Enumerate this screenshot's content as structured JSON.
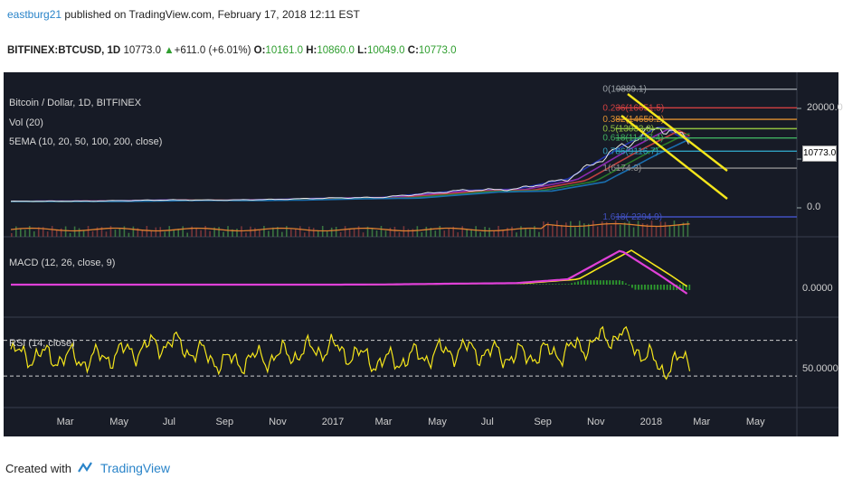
{
  "header": {
    "user": "eastburg21",
    "published": " published on TradingView.com, February 17, 2018 12:11 EST",
    "symbol": "BITFINEX:BTCUSD, 1D",
    "last": "10773.0",
    "change": "+611.0 (+6.01%)",
    "o_label": "O:",
    "o_val": "10161.0",
    "h_label": "H:",
    "h_val": "10860.0",
    "l_label": "L:",
    "l_val": "10049.0",
    "c_label": "C:",
    "c_val": "10773.0"
  },
  "legend": {
    "main": "Bitcoin / Dollar, 1D, BITFINEX",
    "vol": "Vol (20)",
    "sema": "5EMA (10, 20, 50, 100, 200, close)",
    "macd": "MACD (12, 26, close, 9)",
    "rsi": "RSI (14, close)"
  },
  "fib_labels": [
    "0(19889.1)",
    "0.236(16651.5)",
    "0.382(14650.2)",
    "0.5(13033.8)",
    "0.618(11417.4)",
    "0.786(9116.7)",
    "1(6174.3)",
    "1.618(-2294.9)"
  ],
  "price_axis": {
    "top": "20000.0",
    "last": "10773.0",
    "zero": "0.0"
  },
  "macd_axis": "0.0000",
  "rsi_axis": "50.0000",
  "colors": {
    "background": "#171b26",
    "price": "#e8e8e8",
    "channel": "#f5e61b",
    "macd": "#e040d8",
    "signal": "#f5e61b",
    "histogram": "#2e9c2e",
    "rsi": "#f5e61b"
  },
  "footer": {
    "created": "Created with",
    "brand": "TradingView"
  },
  "chart_data": [
    {
      "type": "line",
      "title": "Bitcoin / Dollar, 1D, BITFINEX",
      "x": [
        "Mar",
        "May",
        "Jul",
        "Sep",
        "Nov",
        "2017",
        "Mar",
        "May",
        "Jul",
        "Sep",
        "Nov",
        "2018",
        "Mar",
        "May"
      ],
      "series": [
        {
          "name": "BTCUSD close (approx.)",
          "values": [
            420,
            450,
            650,
            610,
            740,
            970,
            1100,
            2300,
            2500,
            4300,
            9800,
            13500,
            10773
          ]
        }
      ],
      "ylim": [
        -2294.9,
        20000
      ],
      "fib_levels": [
        19889.1,
        16651.5,
        14650.2,
        13033.8,
        11417.4,
        9116.7,
        6174.3,
        -2294.9
      ]
    },
    {
      "type": "line",
      "title": "MACD (12, 26, close, 9)",
      "series": [
        {
          "name": "MACD",
          "values": [
            0,
            0,
            0,
            0,
            0,
            0,
            10,
            60,
            80,
            300,
            1900,
            500,
            -600
          ]
        }
      ]
    },
    {
      "type": "line",
      "title": "RSI (14, close)",
      "series": [
        {
          "name": "RSI",
          "values": [
            55,
            48,
            68,
            45,
            52,
            62,
            45,
            60,
            52,
            58,
            78,
            38,
            50
          ]
        }
      ],
      "ylim": [
        0,
        100
      ]
    }
  ]
}
